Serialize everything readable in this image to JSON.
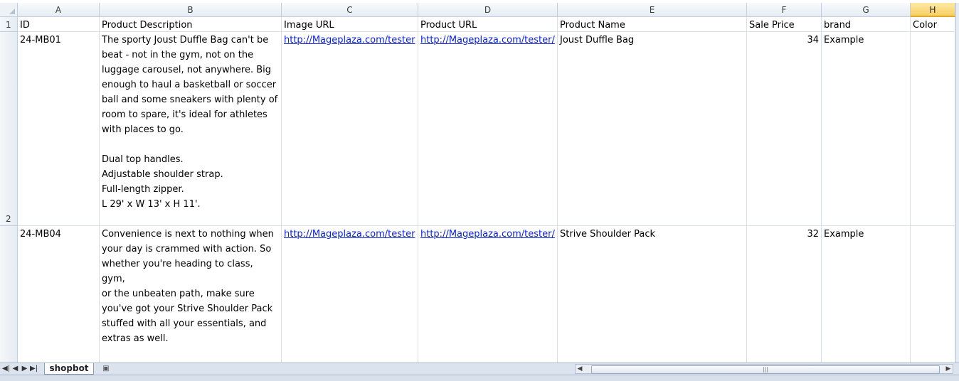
{
  "spreadsheet": {
    "columns": [
      "A",
      "B",
      "C",
      "D",
      "E",
      "F",
      "G",
      "H"
    ],
    "selected_column": "H",
    "rows": {
      "header_row": {
        "row_number": "1",
        "cells": [
          "ID",
          "Product Description",
          "Image URL",
          "Product  URL",
          "Product Name",
          "Sale Price",
          "brand",
          "Color"
        ]
      },
      "row2": {
        "row_number": "2",
        "id": "24-MB01",
        "description": "The sporty Joust Duffle Bag can't be\nbeat - not in the gym, not on the\nluggage carousel, not anywhere. Big\nenough to haul a basketball or soccer\nball and some sneakers with plenty of\nroom to spare, it's ideal for athletes\nwith places to go.\n\nDual top handles.\nAdjustable shoulder strap.\nFull-length zipper.\nL 29' x W 13' x H 11'.",
        "image_url": "http://Mageplaza.com/tester",
        "product_url": "http://Mageplaza.com/tester/",
        "product_name": "Joust Duffle Bag",
        "sale_price": "34",
        "brand": "Example",
        "color": ""
      },
      "row3": {
        "id": "24-MB04",
        "description": "Convenience is next to nothing when\nyour day is crammed with action. So\nwhether you're heading to class, gym,\nor the unbeaten path, make sure\nyou've got your Strive Shoulder Pack\nstuffed with all your essentials, and\nextras as well.\n\nZippered main compartment.",
        "image_url": "http://Mageplaza.com/tester",
        "product_url": "http://Mageplaza.com/tester/",
        "product_name": "Strive Shoulder Pack",
        "sale_price": "32",
        "brand": "Example",
        "color": ""
      }
    }
  },
  "sheet_tabs": {
    "active": "shopbot",
    "nav_icons": [
      "first-sheet-icon",
      "prev-sheet-icon",
      "next-sheet-icon",
      "last-sheet-icon"
    ],
    "nav_glyphs": [
      "◀|",
      "◀",
      "▶",
      "▶|"
    ]
  },
  "colors": {
    "header_bg": "#e6ecf3",
    "selected_header": "#f7cf62",
    "link": "#0b22e0",
    "gridline": "#dadfe6"
  }
}
